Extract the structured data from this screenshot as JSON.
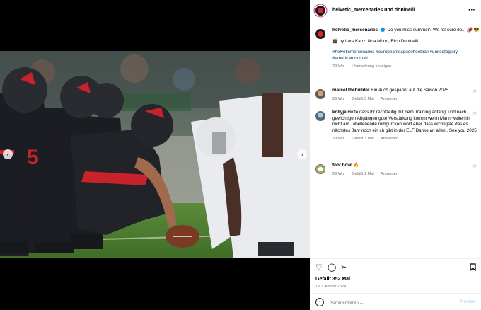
{
  "header": {
    "title": "helvetic_mercenaries und doninelli",
    "more_icon": "ellipsis-icon"
  },
  "caption": {
    "username": "helvetic_mercenaries",
    "text": "Do you miss summer? We for sure do... 🏈 😎",
    "credits": "🎬 by Lars Kauz, Noa Monn, Rico Doninelli",
    "hashtags": "#helveticmercenaries #europeanleagueoffootball #unitedtoglory #americanfootball",
    "time": "29 Wo.",
    "translate": "Übersetzung anzeigen"
  },
  "comments": [
    {
      "username": "marcel.thebuilder",
      "text": "Bin auch gespannt auf die Saison 2025",
      "time": "29 Wo.",
      "likes": "Gefällt 3 Mal",
      "reply": "Antworten"
    },
    {
      "username": "kollyje",
      "text": "Hoffe dass ihr rechtzeitig mit dem Training anfängt und nach gewichtigen Abgängen gute Verstärkung kommt wenn Mann weiterhin nicht am Tabellenende rumgurcken wollt Aber dass wichtigste das es nächstes Jahr noch ein ch gibt in der ELF Danke an allen . See you 2025",
      "time": "29 Wo.",
      "likes": "Gefällt 3 Mal",
      "reply": "Antworten"
    },
    {
      "username": "foot.bowl",
      "text": "🔥",
      "time": "29 Wo.",
      "likes": "Gefällt 1 Mal",
      "reply": "Antworten"
    }
  ],
  "actions": {
    "likes": "Gefällt 352 Mal",
    "date": "12. Oktober 2024",
    "comment_placeholder": "Kommentieren ...",
    "post_label": "Posten"
  },
  "icons": {
    "like": "heart-icon",
    "comment": "comment-icon",
    "share": "share-icon",
    "save": "bookmark-icon",
    "emoji": "emoji-icon"
  },
  "colors": {
    "hashtag": "#00376b",
    "meta": "#737373",
    "post_disabled": "#b3dbff",
    "verified": "#0095f6"
  }
}
